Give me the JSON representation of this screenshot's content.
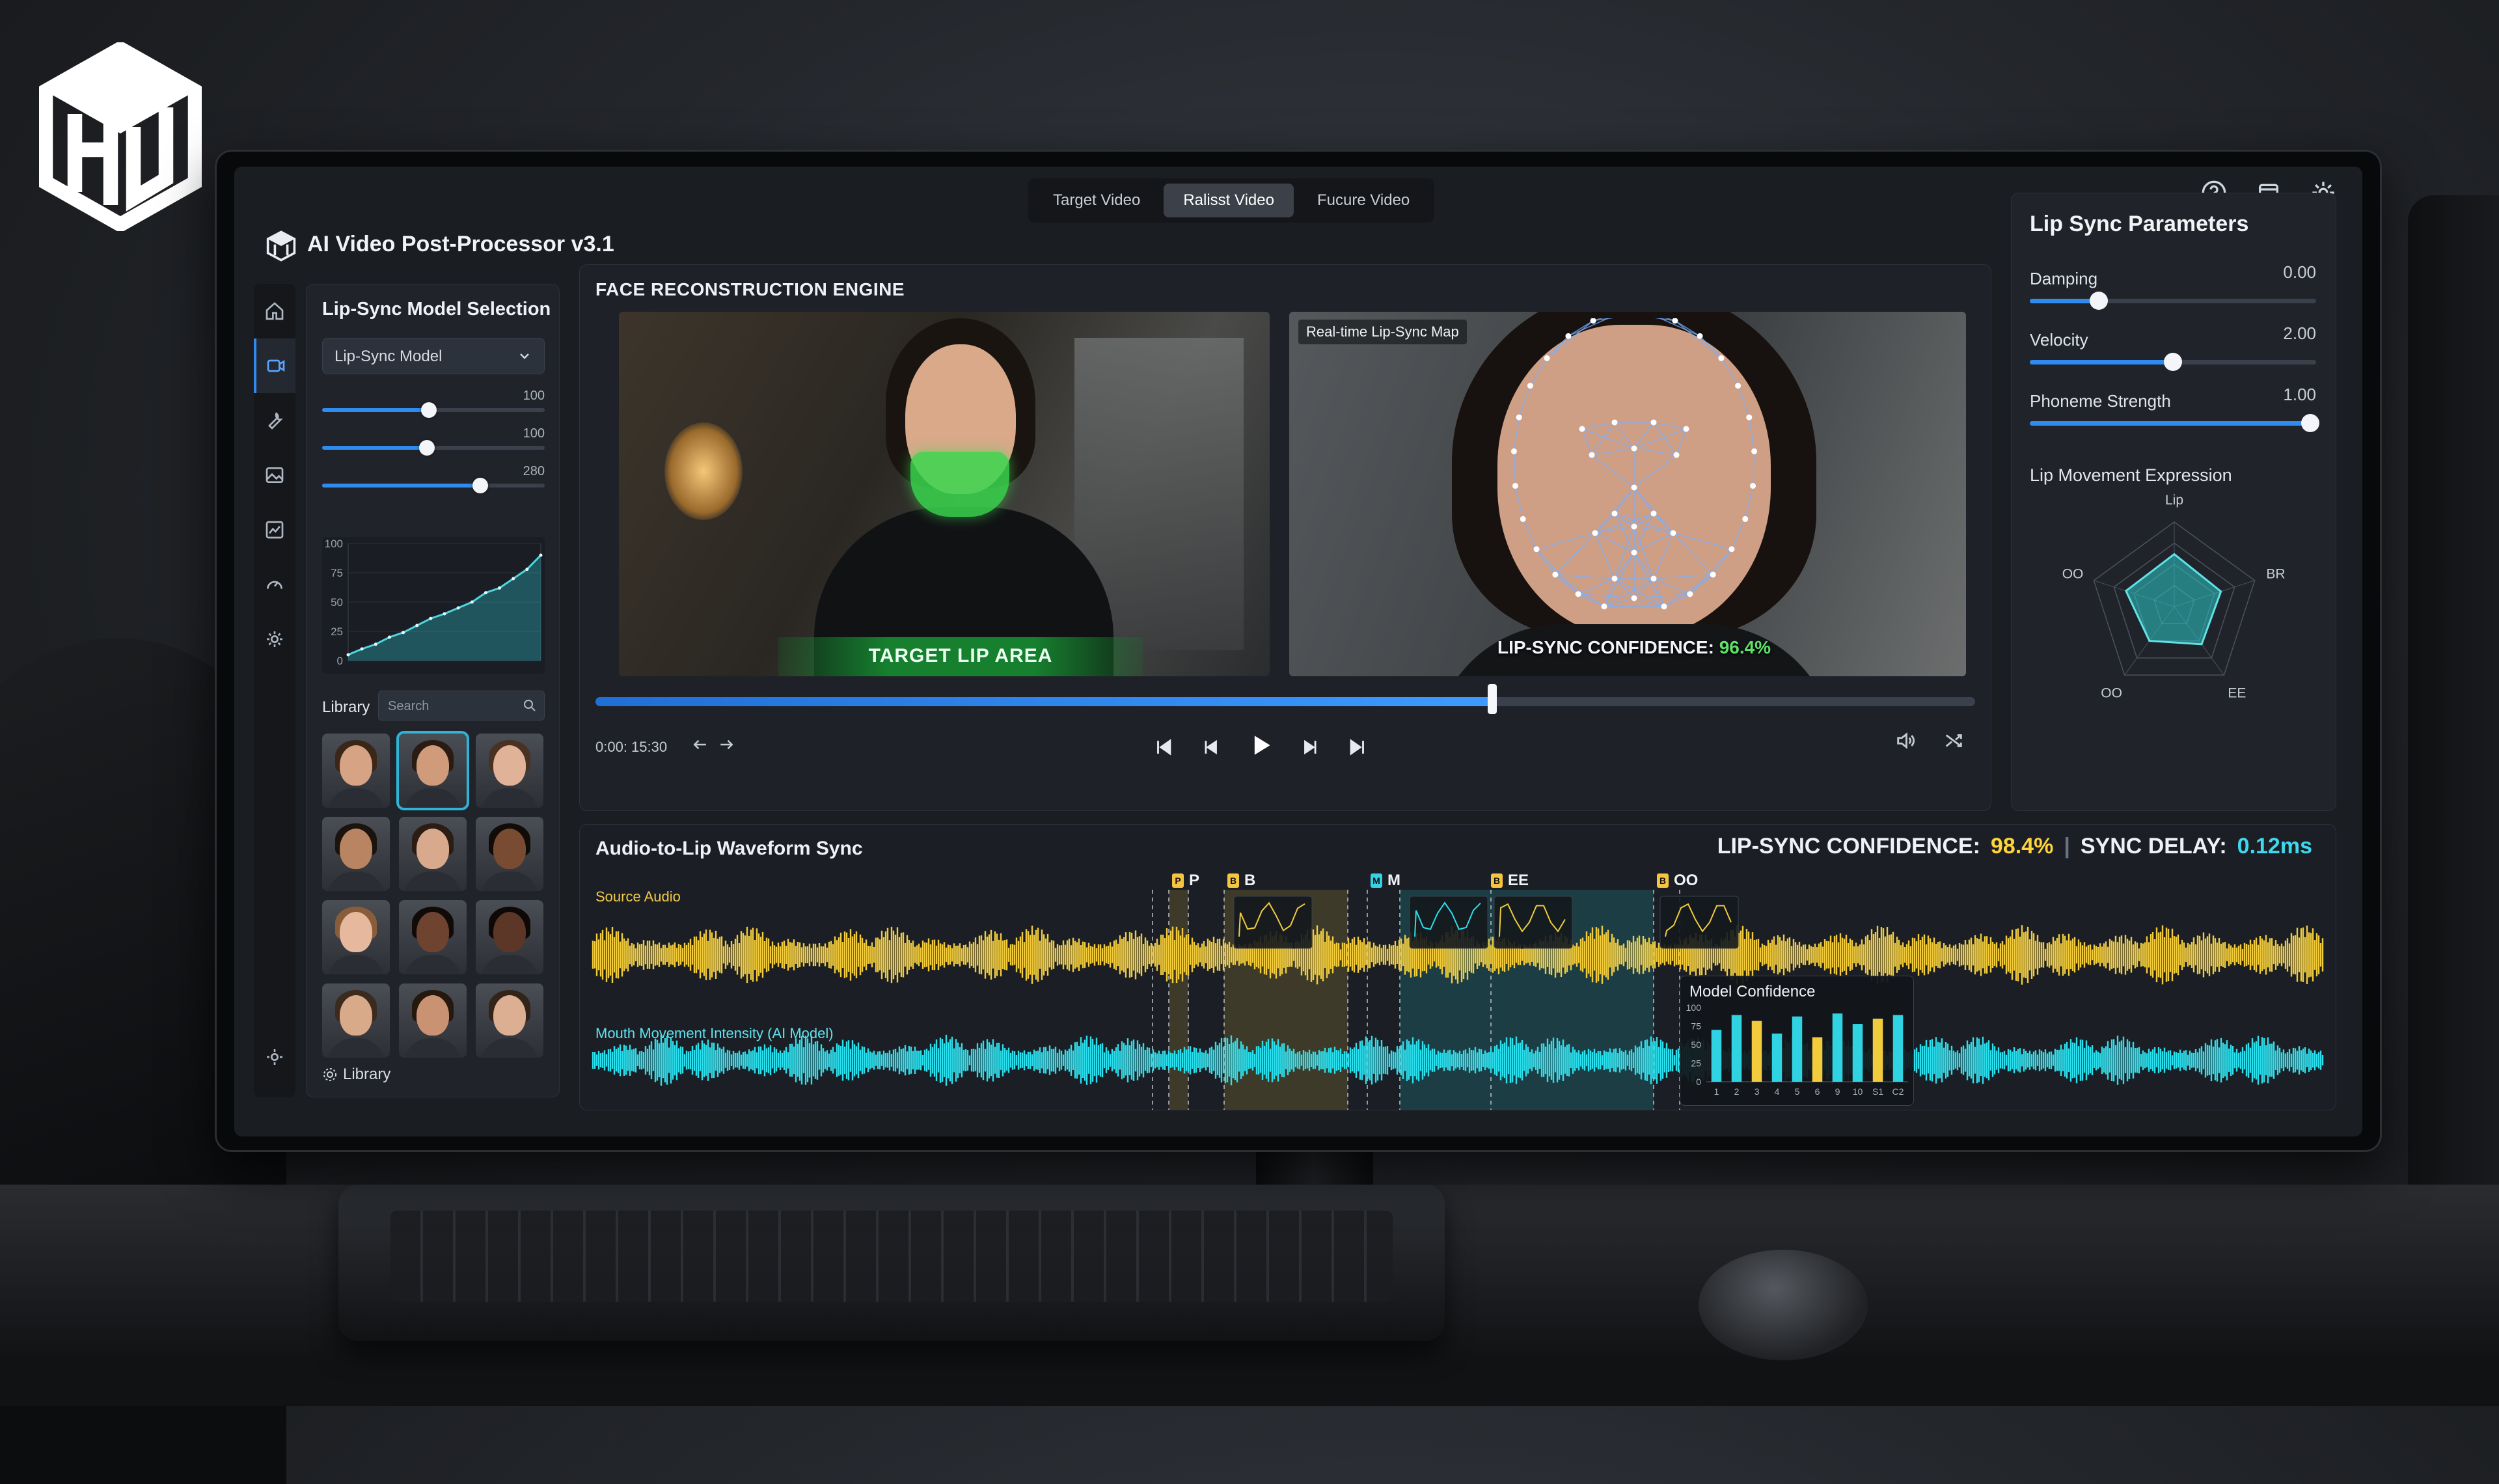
{
  "app": {
    "title": "AI Video Post-Processor v3.1"
  },
  "view_tabs": [
    {
      "label": "Target Video",
      "active": false
    },
    {
      "label": "Ralisst Video",
      "active": true
    },
    {
      "label": "Fucure Video",
      "active": false
    }
  ],
  "top_icons": [
    "help-icon",
    "window-icon",
    "settings-icon"
  ],
  "left_rail": [
    "home-icon",
    "video-icon",
    "wrench-icon",
    "image-icon",
    "chart-icon",
    "gauge-icon",
    "gear-icon",
    "settings-icon"
  ],
  "model_panel": {
    "title": "Lip-Sync Model Selection",
    "select_value": "Lip-Sync Model",
    "sliders": [
      {
        "value_label": "100",
        "fraction": 0.48
      },
      {
        "value_label": "100",
        "fraction": 0.47
      },
      {
        "value_label": "280",
        "fraction": 0.71
      }
    ],
    "mini_chart": {
      "type": "area",
      "y_ticks": [
        "100",
        "75",
        "50",
        "25",
        "0"
      ],
      "ylim": [
        0,
        100
      ],
      "values": [
        5,
        10,
        14,
        20,
        24,
        30,
        36,
        40,
        45,
        50,
        58,
        62,
        70,
        78,
        90
      ]
    }
  },
  "library": {
    "label": "Library",
    "search_placeholder": "Search",
    "footer_label": "Library",
    "faces": [
      {
        "skin": "#d6a385",
        "hair": "#3a2718",
        "selected": false
      },
      {
        "skin": "#cf9b7a",
        "hair": "#2a1c12",
        "selected": true
      },
      {
        "skin": "#e0b399",
        "hair": "#4a3222",
        "selected": false
      },
      {
        "skin": "#b88462",
        "hair": "#1b130d",
        "selected": false
      },
      {
        "skin": "#d8a98c",
        "hair": "#2b1d14",
        "selected": false
      },
      {
        "skin": "#7a4b33",
        "hair": "#120c09",
        "selected": false
      },
      {
        "skin": "#e6b99f",
        "hair": "#8a5d3a",
        "selected": false
      },
      {
        "skin": "#6e4430",
        "hair": "#100b08",
        "selected": false
      },
      {
        "skin": "#5c3626",
        "hair": "#0e0907",
        "selected": false
      },
      {
        "skin": "#d9aa8a",
        "hair": "#3b2a1e",
        "selected": false
      },
      {
        "skin": "#c99272",
        "hair": "#24180f",
        "selected": false
      },
      {
        "skin": "#dcae92",
        "hair": "#33241a",
        "selected": false
      }
    ]
  },
  "engine": {
    "label": "FACE RECONSTRUCTION ENGINE",
    "target_lip_label": "TARGET LIP AREA",
    "map_label": "Real-time Lip-Sync Map",
    "overlay_conf_label": "LIP-SYNC CONFIDENCE:",
    "overlay_conf_value": "96.4%",
    "timeline_fraction": 0.65,
    "timecode": "0:00: 15:30"
  },
  "params": {
    "title": "Lip Sync Parameters",
    "rows": [
      {
        "label": "Damping",
        "value": "0.00",
        "fraction": 0.24
      },
      {
        "label": "Velocity",
        "value": "2.00",
        "fraction": 0.5
      },
      {
        "label": "Phoneme Strength",
        "value": "1.00",
        "fraction": 0.98
      }
    ],
    "expression_title": "Lip Movement Expression",
    "radar": {
      "axes": [
        "Lip",
        "BR",
        "EE",
        "OO",
        "OO"
      ],
      "values": [
        0.62,
        0.58,
        0.55,
        0.5,
        0.6
      ]
    }
  },
  "waveform": {
    "title": "Audio-to-Lip Waveform Sync",
    "conf_label": "LIP-SYNC CONFIDENCE:",
    "conf_value": "98.4%",
    "delay_label": "SYNC DELAY:",
    "delay_value": "0.12ms",
    "source_label": "Source Audio",
    "mouth_label": "Mouth Movement Intensity (AI Model)",
    "source_color": "#f2cc3c",
    "mouth_color": "#2de0ee",
    "phonemes": [
      {
        "label": "P",
        "pin": "P",
        "color": "yellow"
      },
      {
        "label": "B",
        "pin": "B",
        "color": "yellow"
      },
      {
        "label": "M",
        "pin": "M",
        "color": "cyan"
      },
      {
        "label": "EE",
        "pin": "B",
        "color": "yellow"
      },
      {
        "label": "OO",
        "pin": "B",
        "color": "yellow"
      }
    ],
    "model_confidence": {
      "title": "Model Confidence",
      "y_ticks": [
        "100",
        "75",
        "50",
        "25",
        "0"
      ],
      "categories": [
        "1",
        "2",
        "3",
        "4",
        "5",
        "6",
        "9",
        "10",
        "S1",
        "C2"
      ],
      "values": [
        70,
        90,
        82,
        65,
        88,
        60,
        92,
        78,
        85,
        90
      ],
      "ylim": [
        0,
        100
      ]
    }
  },
  "colors": {
    "accent": "#2f8bf0",
    "confidence_yellow": "#ffd43a",
    "delay_cyan": "#3fd9ee",
    "lip_green": "#3ad64e"
  }
}
